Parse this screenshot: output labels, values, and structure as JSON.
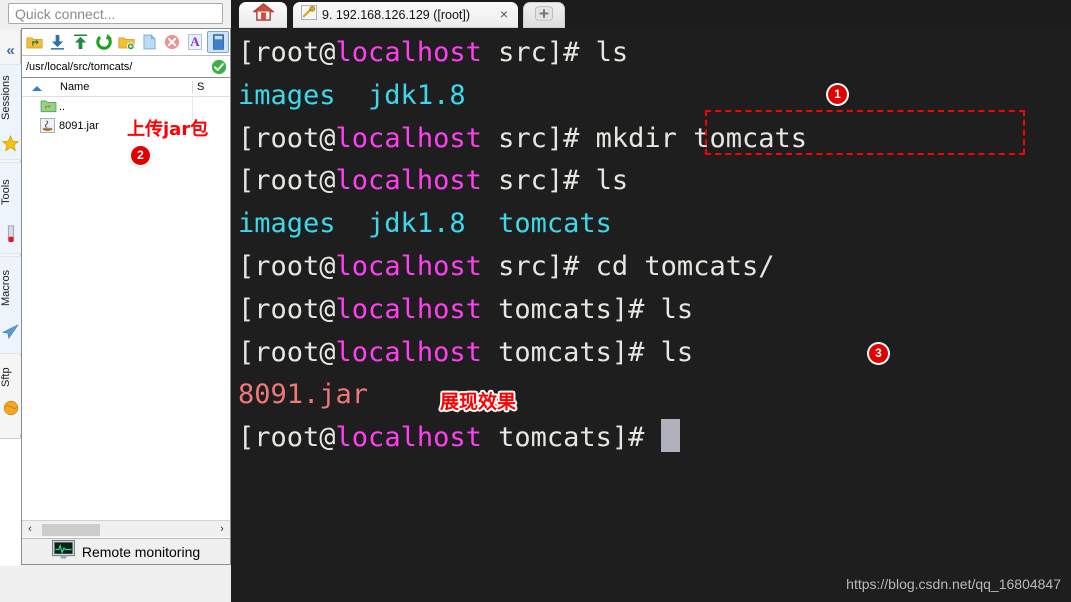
{
  "quick_connect": {
    "placeholder": "Quick connect..."
  },
  "sidebar": {
    "collapse_label": "«",
    "items": [
      {
        "label": "Sessions",
        "icon": "star-icon"
      },
      {
        "label": "Tools",
        "icon": "tools-icon"
      },
      {
        "label": "Macros",
        "icon": "paper-plane-icon"
      },
      {
        "label": "Sftp",
        "icon": "globe-icon"
      }
    ]
  },
  "file_browser": {
    "toolbar": [
      {
        "name": "parent-folder-icon",
        "title": "Go to parent folder",
        "active": false
      },
      {
        "name": "download-icon",
        "title": "Download",
        "active": false
      },
      {
        "name": "upload-icon",
        "title": "Upload",
        "active": false
      },
      {
        "name": "refresh-icon",
        "title": "Refresh",
        "active": false
      },
      {
        "name": "new-folder-icon",
        "title": "New folder",
        "active": false
      },
      {
        "name": "new-file-icon",
        "title": "New file",
        "active": false
      },
      {
        "name": "delete-icon",
        "title": "Delete",
        "active": false
      },
      {
        "name": "rename-icon",
        "title": "Rename",
        "active": false
      },
      {
        "name": "drive-icon",
        "title": "Drive",
        "active": true
      }
    ],
    "path": "/usr/local/src/tomcats/",
    "path_ok": "✓",
    "columns": {
      "name": "Name",
      "size": "S"
    },
    "rows": [
      {
        "name": "..",
        "icon": "parent-folder-icon",
        "size": ""
      },
      {
        "name": "8091.jar",
        "icon": "jar-file-icon",
        "size": ""
      }
    ],
    "hscroll": {
      "left": "‹",
      "right": "›"
    },
    "footer": {
      "label": "Remote monitoring",
      "icon": "monitor-icon"
    }
  },
  "tabs": {
    "home": {
      "icon": "home-icon",
      "label": ""
    },
    "session": {
      "icon": "key-icon",
      "label": "9. 192.168.126.129 ([root])",
      "close": "×"
    },
    "new_tab": {
      "label": "+"
    }
  },
  "terminal": {
    "lines": [
      [
        {
          "t": "[root@",
          "c": "user"
        },
        {
          "t": "localhost",
          "c": "host"
        },
        {
          "t": " src]# ",
          "c": "user"
        },
        {
          "t": "ls",
          "c": "cmd"
        }
      ],
      [
        {
          "t": "images  ",
          "c": "dir"
        },
        {
          "t": "jdk1.8",
          "c": "dir"
        }
      ],
      [
        {
          "t": "[root@",
          "c": "user"
        },
        {
          "t": "localhost",
          "c": "host"
        },
        {
          "t": " src]# ",
          "c": "user"
        },
        {
          "t": "mkdir tomcats",
          "c": "cmd"
        }
      ],
      [
        {
          "t": "[root@",
          "c": "user"
        },
        {
          "t": "localhost",
          "c": "host"
        },
        {
          "t": " src]# ",
          "c": "user"
        },
        {
          "t": "ls",
          "c": "cmd"
        }
      ],
      [
        {
          "t": "images  ",
          "c": "dir"
        },
        {
          "t": "jdk1.8  ",
          "c": "dir"
        },
        {
          "t": "tomcats",
          "c": "dir"
        }
      ],
      [
        {
          "t": "[root@",
          "c": "user"
        },
        {
          "t": "localhost",
          "c": "host"
        },
        {
          "t": " src]# ",
          "c": "user"
        },
        {
          "t": "cd tomcats/",
          "c": "cmd"
        }
      ],
      [
        {
          "t": "[root@",
          "c": "user"
        },
        {
          "t": "localhost",
          "c": "host"
        },
        {
          "t": " tomcats]# ",
          "c": "user"
        },
        {
          "t": "ls",
          "c": "cmd"
        }
      ],
      [
        {
          "t": "[root@",
          "c": "user"
        },
        {
          "t": "localhost",
          "c": "host"
        },
        {
          "t": " tomcats]# ",
          "c": "user"
        },
        {
          "t": "ls",
          "c": "cmd"
        }
      ],
      [
        {
          "t": "8091.jar",
          "c": "file"
        }
      ],
      [
        {
          "t": "[root@",
          "c": "user"
        },
        {
          "t": "localhost",
          "c": "host"
        },
        {
          "t": " tomcats]# ",
          "c": "user"
        }
      ]
    ],
    "colors": {
      "background": "#1e1e1e",
      "user": "#e8e6e0",
      "host": "#ff3ff0",
      "dir": "#3fd8e8",
      "file": "#f07878",
      "cursor": "#b0b0bd"
    }
  },
  "annotations": {
    "badge1": "1",
    "badge2": "2",
    "badge3": "3",
    "note_upload_jar": "上传jar包",
    "note_result": "展现效果",
    "highlight_color": "#ff0000"
  },
  "watermark": "https://blog.csdn.net/qq_16804847"
}
